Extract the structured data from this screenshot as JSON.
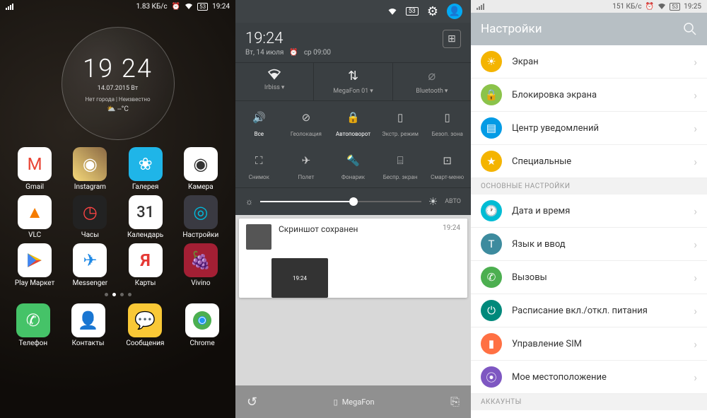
{
  "p1": {
    "status": {
      "speed": "1.83 КБ/с",
      "time": "19:24",
      "battery": "53"
    },
    "clock": {
      "time": "19 24",
      "date": "14.07.2015  Вт",
      "loc": "Нет города | Неизвестно",
      "temp": "⛅ --°C"
    },
    "apps": {
      "r1": [
        {
          "l": "Gmail"
        },
        {
          "l": "Instagram"
        },
        {
          "l": "Галерея"
        },
        {
          "l": "Камера"
        }
      ],
      "r2": [
        {
          "l": "VLC"
        },
        {
          "l": "Часы"
        },
        {
          "l": "Календарь"
        },
        {
          "l": "Настройки"
        }
      ],
      "r3": [
        {
          "l": "Play Маркет"
        },
        {
          "l": "Messenger"
        },
        {
          "l": "Карты"
        },
        {
          "l": "Vivino"
        }
      ],
      "dock": [
        {
          "l": "Телефон"
        },
        {
          "l": "Контакты"
        },
        {
          "l": "Сообщения"
        },
        {
          "l": "Chrome"
        }
      ]
    },
    "cal_day": "31"
  },
  "p2": {
    "time": "19:24",
    "date": "Вт, 14 июля",
    "alarm": "ср 09:00",
    "conn": [
      {
        "l": "Irbiss"
      },
      {
        "l": "MegaFon 01"
      },
      {
        "l": "Bluetooth"
      }
    ],
    "toggles1": [
      {
        "l": "Все"
      },
      {
        "l": "Геолокация"
      },
      {
        "l": "Автоповорот"
      },
      {
        "l": "Экстр. режим"
      },
      {
        "l": "Безоп. зона"
      }
    ],
    "toggles2": [
      {
        "l": "Снимок"
      },
      {
        "l": "Полет"
      },
      {
        "l": "Фонарик"
      },
      {
        "l": "Беспр. экран"
      },
      {
        "l": "Смарт-меню"
      }
    ],
    "bri_auto": "АВТО",
    "notif": {
      "title": "Скриншот сохранен",
      "time": "19:24"
    },
    "bottom": "MegaFon"
  },
  "p3": {
    "status": {
      "speed": "151 КБ/с",
      "time": "19:25",
      "battery": "53"
    },
    "title": "Настройки",
    "items1": [
      {
        "l": "Экран",
        "c": "si-screen",
        "i": "☀"
      },
      {
        "l": "Блокировка экрана",
        "c": "si-lock",
        "i": "🔒"
      },
      {
        "l": "Центр уведомлений",
        "c": "si-notif",
        "i": "▤"
      },
      {
        "l": "Специальные",
        "c": "si-spec",
        "i": "★"
      }
    ],
    "section": "ОСНОВНЫЕ НАСТРОЙКИ",
    "items2": [
      {
        "l": "Дата и время",
        "c": "si-date",
        "i": "🕐"
      },
      {
        "l": "Язык и ввод",
        "c": "si-lang",
        "i": "T"
      },
      {
        "l": "Вызовы",
        "c": "si-call",
        "i": "✆"
      },
      {
        "l": "Расписание вкл./откл. питания",
        "c": "si-power",
        "i": "⏻"
      },
      {
        "l": "Управление SIM",
        "c": "si-sim",
        "i": "▮"
      },
      {
        "l": "Мое местоположение",
        "c": "si-loc",
        "i": "⦿"
      }
    ],
    "section2": "АККАУНТЫ"
  }
}
